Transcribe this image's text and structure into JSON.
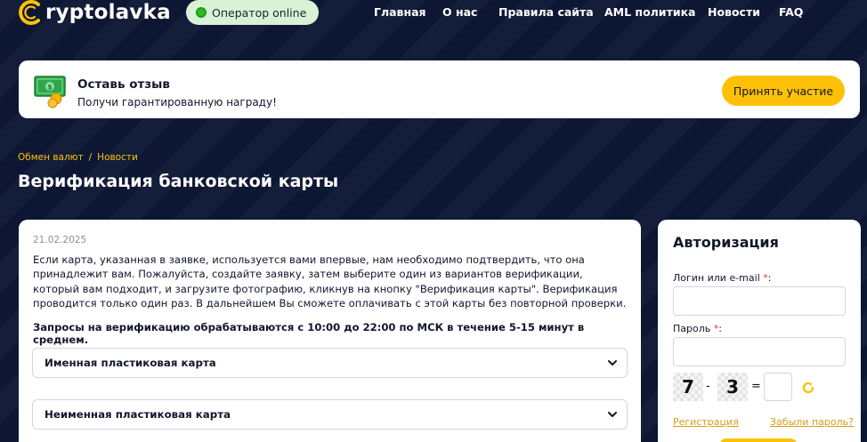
{
  "header": {
    "logo_text": "ryptolavka",
    "operator_status": "Оператор online",
    "nav": [
      {
        "label": "Главная"
      },
      {
        "label": "О нас"
      },
      {
        "label": "Правила сайта"
      },
      {
        "label": "AML политика"
      },
      {
        "label": "Новости"
      },
      {
        "label": "FAQ"
      }
    ]
  },
  "review_banner": {
    "title": "Оставь отзыв",
    "subtitle": "Получи гарантированную награду!",
    "button": "Принять участие"
  },
  "breadcrumb": {
    "items": [
      {
        "label": "Обмен валют"
      },
      {
        "label": "Новости"
      }
    ],
    "separator": "/"
  },
  "page_title": "Верификация банковской карты",
  "article": {
    "date": "21.02.2025",
    "paragraph": "Если карта, указанная в заявке, используется вами впервые, нам необходимо подтвердить, что она принадлежит вам. Пожалуйста, создайте заявку, затем выберите один из вариантов верификации, который вам подходит, и загрузите фотографию, кликнув на кнопку \"Верификация карты\". Верификация проводится только один раз. В дальнейшем Вы сможете оплачивать с этой карты без повторной проверки.",
    "bold_note": "Запросы на верификацию обрабатываются с 10:00 до 22:00 по МСК в течение 5-15 минут в среднем.",
    "accordions": [
      {
        "label": "Именная пластиковая карта"
      },
      {
        "label": "Неименная пластиковая карта"
      }
    ]
  },
  "auth": {
    "title": "Авторизация",
    "login_label": "Логин или e-mail",
    "password_label": "Пароль",
    "required_mark": "*",
    "label_suffix": ":",
    "captcha": {
      "a": "7",
      "op": "-",
      "b": "3",
      "eq": "="
    },
    "register_link": "Регистрация",
    "forgot_link": "Забыли пароль?"
  },
  "colors": {
    "background": "#0d1733",
    "accent": "#ffc107",
    "online_badge": "#d9f2d6",
    "online_dot": "#2dbb2a",
    "required": "#e53935"
  },
  "icons": {
    "logo": "cryptolavka-c-logo",
    "review": "money-banknote-icon",
    "accordion": "chevron-down-icon",
    "captcha_refresh": "refresh-icon"
  }
}
